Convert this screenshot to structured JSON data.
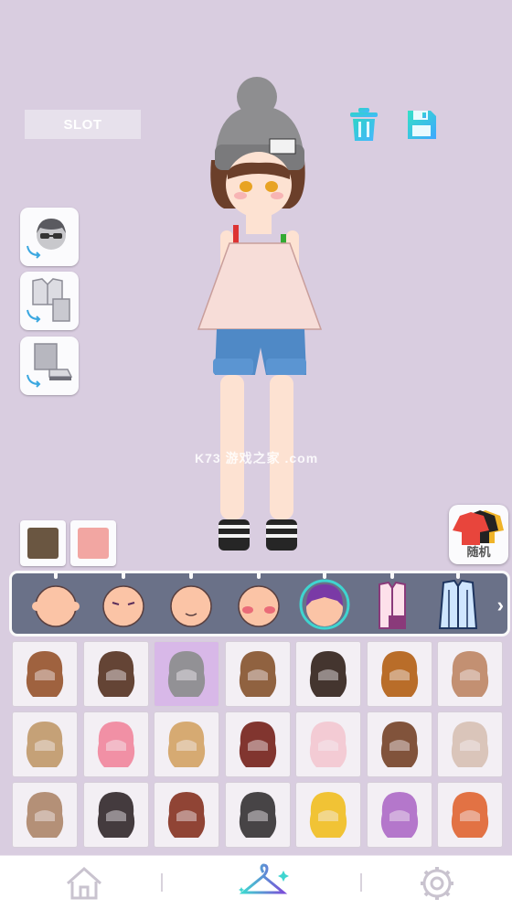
{
  "header": {
    "slot_label": "SLOT"
  },
  "icons": {
    "trash": "trash-icon",
    "save": "floppy-save-icon"
  },
  "side_buttons": [
    {
      "name": "face-swap-icon"
    },
    {
      "name": "outfit-swap-icon"
    },
    {
      "name": "bottoms-swap-icon"
    }
  ],
  "colors": {
    "swatch_1": "#6a5641",
    "swatch_2": "#f2a6a2",
    "background": "#d9cde0",
    "category_bar": "#6a7188",
    "selected_cell": "#d8b8e8",
    "accent": "#3fd5d0"
  },
  "random_button": {
    "label": "随机"
  },
  "categories": [
    {
      "name": "face-base-icon"
    },
    {
      "name": "eyes-icon"
    },
    {
      "name": "mouth-icon"
    },
    {
      "name": "blush-icon"
    },
    {
      "name": "hair-icon",
      "selected": true
    },
    {
      "name": "top-icon"
    },
    {
      "name": "coat-icon"
    }
  ],
  "watermark": {
    "text": "K73 游戏之家 .com"
  },
  "grid": {
    "selected_index": 2,
    "items": [
      "hair-item-1",
      "hair-item-2",
      "hair-item-3",
      "hair-item-4",
      "hair-item-5",
      "hair-item-6",
      "hair-item-7",
      "hair-item-8",
      "hair-item-9",
      "hair-item-10",
      "hair-item-11",
      "hair-item-12",
      "hair-item-13",
      "hair-item-14",
      "hair-item-15",
      "hair-item-16",
      "hair-item-17",
      "hair-item-18",
      "hair-item-19",
      "hair-item-20",
      "hair-item-21"
    ]
  },
  "bottom_nav": [
    {
      "name": "home-icon"
    },
    {
      "name": "hanger-icon",
      "active": true
    },
    {
      "name": "settings-icon"
    }
  ]
}
